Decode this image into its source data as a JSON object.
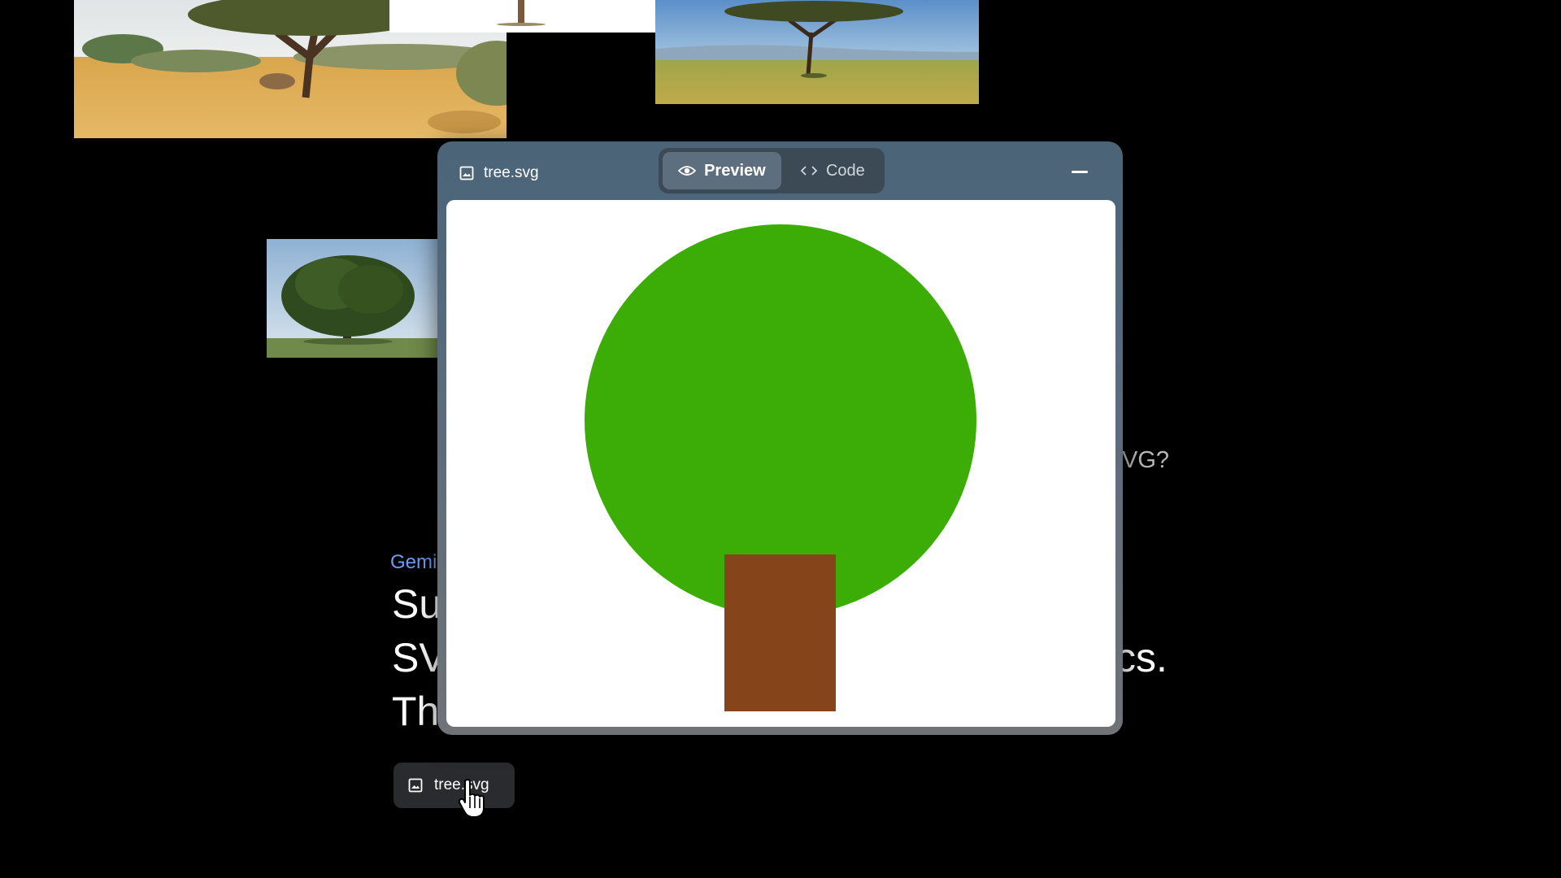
{
  "window": {
    "filename": "tree.svg",
    "tabs": [
      {
        "label": "Preview",
        "icon": "eye-icon",
        "active": true
      },
      {
        "label": "Code",
        "icon": "code-brackets-icon",
        "active": false
      }
    ],
    "minimize_icon": "minus-icon"
  },
  "preview": {
    "foliage_color": "#3cad06",
    "trunk_color": "#86441a",
    "background_color": "#ffffff"
  },
  "background_page": {
    "brand_label": "Gemi",
    "headline_lines": [
      "Su",
      "SV",
      "Th"
    ],
    "headline_right_fragment": "cs.",
    "question_tail": "VG?"
  },
  "file_chip": {
    "label": "tree.svg",
    "icon": "image-icon"
  },
  "photos": [
    {
      "name": "savanna-acacia-photo"
    },
    {
      "name": "white-photo-fragment"
    },
    {
      "name": "serengeti-acacia-photo"
    },
    {
      "name": "oak-tree-photo"
    }
  ],
  "colors": {
    "brand_blue": "#6e9cf5",
    "page_background": "#000000",
    "chip_background": "#2a2b2e"
  }
}
